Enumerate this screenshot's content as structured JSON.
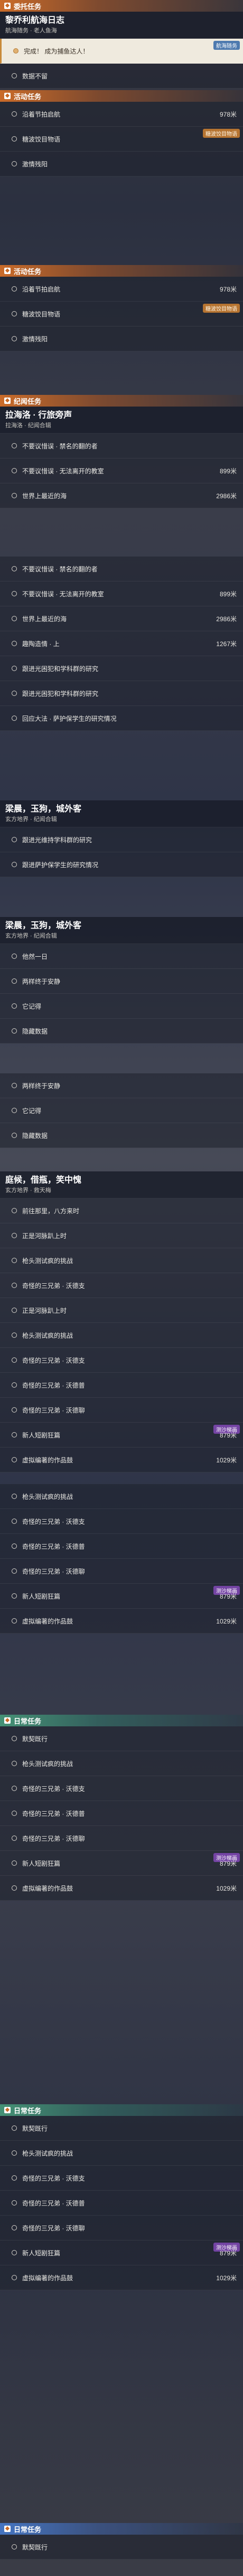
{
  "s1": {
    "cat": "委托任务",
    "title": "黎乔利航海日志",
    "sub": "航海随务 · 老人鱼海",
    "rows": [
      {
        "label": "完成！ 成为捕鱼达人！",
        "tag": "航海随务",
        "hl": true
      },
      {
        "label": "数据不留"
      }
    ]
  },
  "s2": {
    "cat": "活动任务",
    "rows": [
      {
        "label": "沿着节拍启航",
        "dist": "978米"
      },
      {
        "label": "糖波饺目物语",
        "tag": "糖波饺目物语"
      },
      {
        "label": "激情残阳"
      }
    ]
  },
  "s3": {
    "cat": "活动任务",
    "rows": [
      {
        "label": "沿着节拍启航",
        "dist": "978米"
      },
      {
        "label": "糖波饺目物语",
        "tag": "糖波饺目物语"
      },
      {
        "label": "激情残阳"
      }
    ]
  },
  "s4": {
    "cat": "纪闻任务",
    "title": "拉海洛 · 行旅旁声",
    "sub": "拉海洛 · 纪闻合辑",
    "rows": [
      {
        "label": "不要议惜误 · 禁名的翻的者"
      },
      {
        "label": "不要议惜误 · 无法离开的教室",
        "dist": "899米"
      },
      {
        "label": "世界上最近的海",
        "dist": "2986米"
      }
    ]
  },
  "s5": {
    "rows": [
      {
        "label": "不要议惜误 · 禁名的翻的者"
      },
      {
        "label": "不要议惜误 · 无法离开的教室",
        "dist": "899米"
      },
      {
        "label": "世界上最近的海",
        "dist": "2986米"
      },
      {
        "label": "趣陶造情 · 上",
        "dist": "1267米"
      },
      {
        "label": "跟进光困犯和学科群的研究"
      },
      {
        "label": "跟进光困犯和学科群的研究"
      },
      {
        "label": "回应大法 · 萨护保学生的研究情况"
      }
    ]
  },
  "s6": {
    "title": "梁晨，玉狗，城外客",
    "sub": "玄方地界 · 纪闻合辑",
    "rows": [
      {
        "label": "跟进光维持学科群的研究"
      },
      {
        "label": "跟进萨护保学生的研究情况"
      }
    ]
  },
  "s7": {
    "title": "梁晨，玉狗，城外客",
    "sub": "玄方地界 · 纪闻合辑",
    "rows": [
      {
        "label": "他然一日"
      },
      {
        "label": "两样终于安静"
      },
      {
        "label": "它记得"
      },
      {
        "label": "隐藏数据"
      }
    ]
  },
  "s8": {
    "rows": [
      {
        "label": "两样终于安静"
      },
      {
        "label": "它记得"
      },
      {
        "label": "隐藏数据"
      }
    ]
  },
  "s9": {
    "title": "庭候，借瓶，笑中愧",
    "sub": "玄方地界 · 救天梅",
    "rows": [
      {
        "label": "前往那里，八方来时"
      },
      {
        "label": "正是河脉趴上时"
      },
      {
        "label": "枪头测试疯的挑战"
      },
      {
        "label": "奇怪的三兄弟 · 沃德支"
      },
      {
        "label": "正是河脉趴上时"
      },
      {
        "label": "枪头测试疯的挑战"
      },
      {
        "label": "奇怪的三兄弟 · 沃德支"
      },
      {
        "label": "奇怪的三兄弟 · 沃德普"
      },
      {
        "label": "奇怪的三兄弟 · 沃德聊"
      },
      {
        "label": "新人短剧狂篇",
        "dist": "879米",
        "tag": "测沙梯画"
      },
      {
        "label": "虚拟编著的作品鼓",
        "dist": "1029米"
      }
    ]
  },
  "s10": {
    "rows": [
      {
        "label": "枪头测试疯的挑战"
      },
      {
        "label": "奇怪的三兄弟 · 沃德支"
      },
      {
        "label": "奇怪的三兄弟 · 沃德普"
      },
      {
        "label": "奇怪的三兄弟 · 沃德聊"
      },
      {
        "label": "新人短剧狂篇",
        "dist": "879米",
        "tag": "测沙梯画"
      },
      {
        "label": "虚拟编著的作品鼓",
        "dist": "1029米"
      }
    ]
  },
  "s11": {
    "cat": "日常任务",
    "rows": [
      {
        "label": "默契既行"
      },
      {
        "label": "枪头测试疯的挑战"
      },
      {
        "label": "奇怪的三兄弟 · 沃德支"
      },
      {
        "label": "奇怪的三兄弟 · 沃德普"
      },
      {
        "label": "奇怪的三兄弟 · 沃德聊"
      },
      {
        "label": "新人短剧狂篇",
        "dist": "879米",
        "tag": "测沙梯画"
      },
      {
        "label": "虚拟编著的作品鼓",
        "dist": "1029米"
      }
    ]
  },
  "s12": {
    "cat": "日常任务",
    "rows": [
      {
        "label": "默契既行"
      },
      {
        "label": "枪头测试疯的挑战"
      },
      {
        "label": "奇怪的三兄弟 · 沃德支"
      },
      {
        "label": "奇怪的三兄弟 · 沃德普"
      },
      {
        "label": "奇怪的三兄弟 · 沃德聊"
      },
      {
        "label": "新人短剧狂篇",
        "dist": "879米",
        "tag": "测沙梯画"
      },
      {
        "label": "虚拟编著的作品鼓",
        "dist": "1029米"
      }
    ]
  },
  "s13": {
    "cat": "日常任务",
    "rows": [
      {
        "label": "默契既行"
      }
    ]
  }
}
